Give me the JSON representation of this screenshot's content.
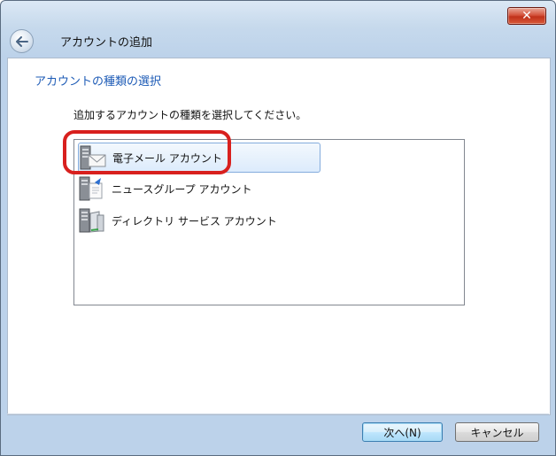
{
  "window": {
    "title": "アカウントの追加",
    "close_label": "✕"
  },
  "page": {
    "section_title": "アカウントの種類の選択",
    "instruction": "追加するアカウントの種類を選択してください。"
  },
  "account_types": [
    {
      "label": "電子メール アカウント",
      "icon": "email-account-icon",
      "selected": true
    },
    {
      "label": "ニュースグループ アカウント",
      "icon": "newsgroup-account-icon",
      "selected": false
    },
    {
      "label": "ディレクトリ サービス アカウント",
      "icon": "directory-service-account-icon",
      "selected": false
    }
  ],
  "buttons": {
    "next": "次へ(N)",
    "cancel": "キャンセル"
  },
  "colors": {
    "highlight_ring": "#d8201e",
    "section_title": "#1d5bb6"
  }
}
